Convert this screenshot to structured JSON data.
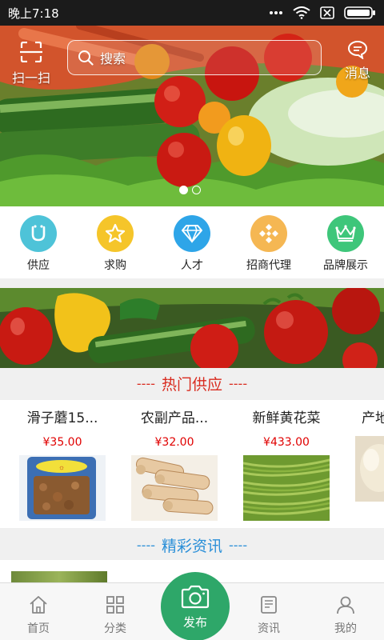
{
  "status_bar": {
    "time": "晚上7:18"
  },
  "header": {
    "scan_label": "扫一扫",
    "search_placeholder": "搜索",
    "message_label": "消息"
  },
  "carousel": {
    "total": 2,
    "active_index": 0
  },
  "categories": [
    {
      "label": "供应",
      "icon": "u-icon",
      "color": "#4ec3d8"
    },
    {
      "label": "求购",
      "icon": "star-icon",
      "color": "#f5c52a"
    },
    {
      "label": "人才",
      "icon": "diamond-icon",
      "color": "#2ea5e8"
    },
    {
      "label": "招商代理",
      "icon": "diamonds-icon",
      "color": "#f5b753"
    },
    {
      "label": "品牌展示",
      "icon": "crown-icon",
      "color": "#3ec67a"
    }
  ],
  "hot_supply": {
    "title": "热门供应",
    "title_color": "#d92b1f",
    "items": [
      {
        "name": "滑子蘑15...",
        "price": "¥35.00"
      },
      {
        "name": "农副产品...",
        "price": "¥32.00"
      },
      {
        "name": "新鲜黄花菜",
        "price": "¥433.00"
      },
      {
        "name": "产地",
        "price": ""
      }
    ]
  },
  "news_section": {
    "title": "精彩资讯",
    "title_color": "#2a8fd8"
  },
  "bottom_nav": {
    "home": "首页",
    "category": "分类",
    "publish": "发布",
    "news": "资讯",
    "mine": "我的"
  },
  "colors": {
    "accent_green": "#2ea769",
    "price_red": "#e00000"
  }
}
